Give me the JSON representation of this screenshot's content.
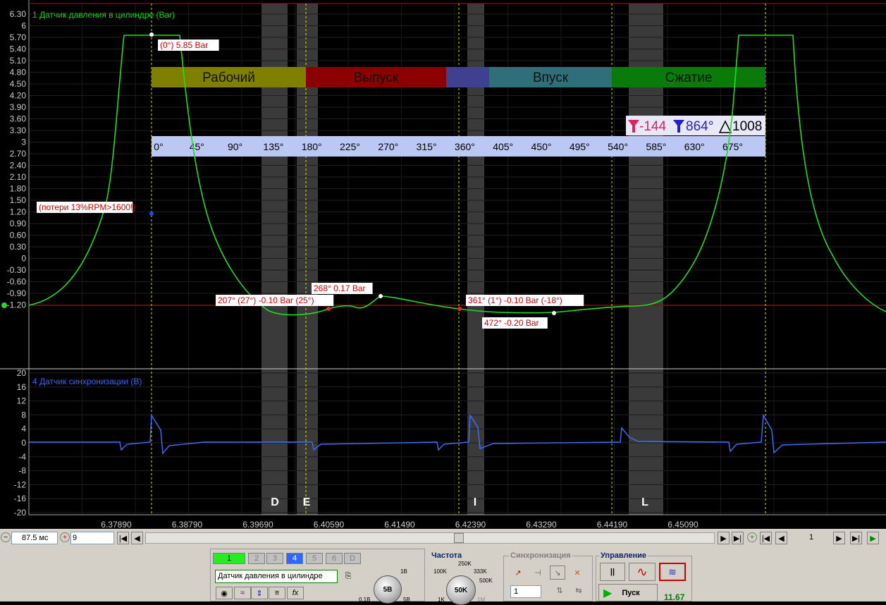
{
  "channel1": {
    "title": "1 Датчик давления в цилиндре (Bar)",
    "color": "#00dd00",
    "y_ticks": [
      "6.30",
      "6",
      "5.70",
      "5.40",
      "5.10",
      "4.80",
      "4.50",
      "4.20",
      "3.90",
      "3.60",
      "3.30",
      "3",
      "2.70",
      "2.40",
      "2.10",
      "1.80",
      "1.50",
      "1.20",
      "0.90",
      "0.60",
      "0.30",
      "0",
      "-0.30",
      "-0.60",
      "-0.90",
      "-1.20"
    ]
  },
  "channel4": {
    "title": "4 Датчик синхронизации (В)",
    "color": "#3366ff",
    "y_ticks": [
      "20",
      "16",
      "12",
      "8",
      "4",
      "0",
      "-4",
      "-8",
      "-12",
      "-16",
      "-20"
    ]
  },
  "strokes": [
    {
      "label": "Рабочий",
      "color": "#808000"
    },
    {
      "label": "Выпуск",
      "color": "#8b0000"
    },
    {
      "label": "",
      "color": "#404090"
    },
    {
      "label": "Впуск",
      "color": "#2e6f7a"
    },
    {
      "label": "Сжатие",
      "color": "#0a7a0a"
    }
  ],
  "angle_scale": [
    "0°",
    "45°",
    "90°",
    "135°",
    "180°",
    "225°",
    "270°",
    "315°",
    "360°",
    "405°",
    "450°",
    "495°",
    "540°",
    "585°",
    "630°",
    "675°"
  ],
  "cursor_info": {
    "a": "-144",
    "b": "864°",
    "delta": "1008"
  },
  "annotations": [
    "(0°) 5.85 Bar",
    "(потери 13%RPM>1600!)",
    "207° (27°) -0.10 Bar (25°)",
    "268° 0.17 Bar",
    "361° (1°) -0.10 Bar (-18°)",
    "472° -0.20 Bar"
  ],
  "markers": [
    "D",
    "E",
    "I",
    "L"
  ],
  "time_axis": [
    "6.37890",
    "6.38790",
    "6.39690",
    "6.40590",
    "6.41490",
    "6.42390",
    "6.43290",
    "6.44190",
    "6.45090"
  ],
  "toolbar": {
    "timebase": "87.5 мс",
    "buffer": "9",
    "frame": "1"
  },
  "channels_group": {
    "buttons": [
      "1",
      "2",
      "3",
      "4",
      "5",
      "6",
      "D"
    ],
    "selected_channel": "Датчик давления в цилиндре",
    "range_dial": "5В",
    "range_labels": [
      "1В",
      "0.1В",
      "5В"
    ]
  },
  "frequency_group": {
    "title": "Частота",
    "dial": "50K",
    "labels": [
      "250K",
      "100K",
      "333K",
      "500K",
      "1K",
      "1M"
    ]
  },
  "sync_group": {
    "title": "Синхронизация",
    "channel": "1"
  },
  "control_group": {
    "title": "Управление",
    "start_label": "Пуск",
    "value": "11.67"
  }
}
